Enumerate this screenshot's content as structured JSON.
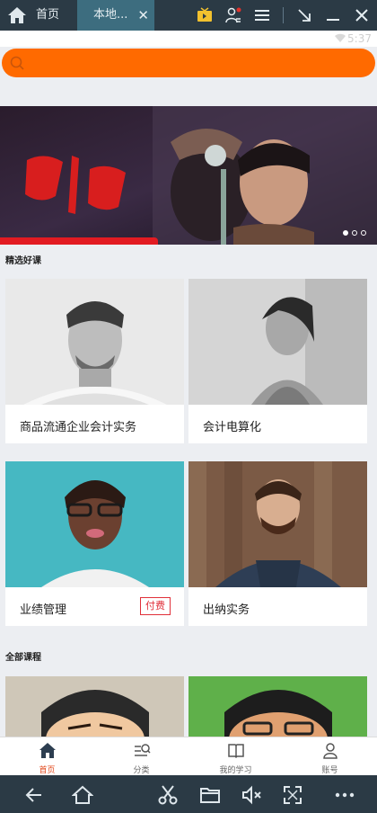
{
  "emulator": {
    "tabs": [
      {
        "label": "首页"
      },
      {
        "label": "本地..."
      }
    ],
    "close_glyph": "✕"
  },
  "status": {
    "time": "5:37"
  },
  "search": {
    "placeholder": ""
  },
  "banner": {
    "active_slide": 1,
    "slide_count": 3
  },
  "sections": {
    "featured": "精选好课",
    "all": "全部课程"
  },
  "featured_courses": [
    {
      "title": "商品流通企业会计实务",
      "badge": ""
    },
    {
      "title": "会计电算化",
      "badge": ""
    },
    {
      "title": "业绩管理",
      "badge": "付费"
    },
    {
      "title": "出纳实务",
      "badge": ""
    }
  ],
  "tabbar": {
    "items": [
      {
        "label": "首页",
        "icon": "home-icon",
        "active": true
      },
      {
        "label": "分类",
        "icon": "category-icon",
        "active": false
      },
      {
        "label": "我的学习",
        "icon": "book-icon",
        "active": false
      },
      {
        "label": "账号",
        "icon": "person-icon",
        "active": false
      }
    ]
  },
  "colors": {
    "accent": "#ff6a00",
    "tab_active": "#e2491c",
    "badge": "#e0303a"
  }
}
